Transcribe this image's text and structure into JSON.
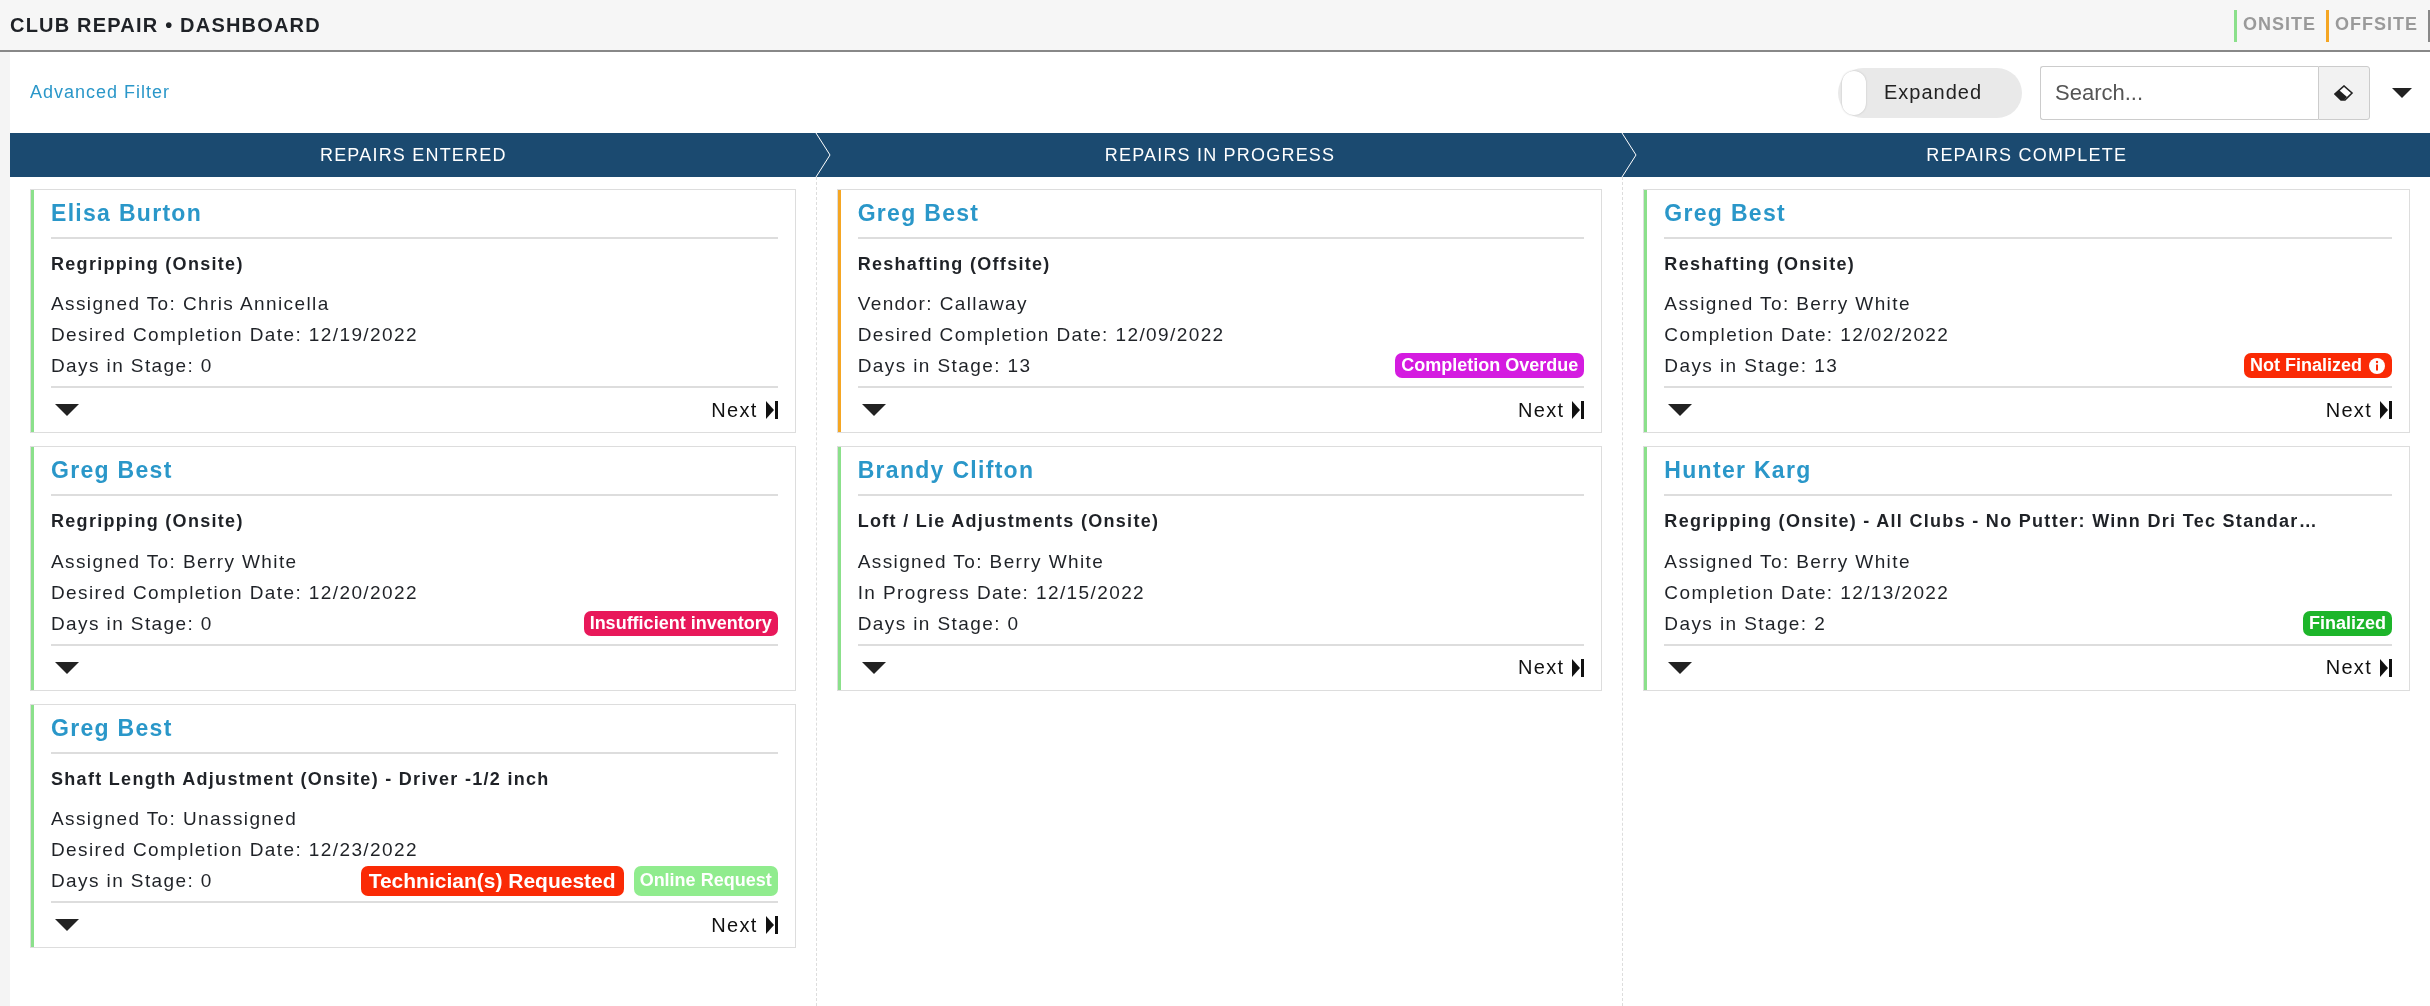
{
  "header": {
    "title": "CLUB REPAIR • DASHBOARD",
    "legend": [
      {
        "label": "ONSITE",
        "color": "#8be08b"
      },
      {
        "label": "OFFSITE",
        "color": "#f5a623"
      }
    ]
  },
  "toolbar": {
    "filter_link": "Advanced Filter",
    "expanded_toggle": {
      "label": "Expanded",
      "on": false
    },
    "search": {
      "placeholder": "Search..."
    }
  },
  "stages": [
    {
      "title": "REPAIRS ENTERED",
      "cards": [
        {
          "name": "Elisa Burton",
          "color": "#8be08b",
          "service": "Regripping (Onsite)",
          "lines": [
            "Assigned To: Chris Annicella",
            "Desired Completion Date: 12/19/2022",
            "Days in Stage: 0"
          ],
          "next": "Next"
        },
        {
          "name": "Greg Best",
          "color": "#8be08b",
          "service": "Regripping (Onsite)",
          "lines": [
            "Assigned To: Berry White",
            "Desired Completion Date: 12/20/2022",
            "Days in Stage: 0"
          ],
          "badges": [
            {
              "label": "Insufficient inventory",
              "color": "#e8185a",
              "kind": "plain"
            }
          ]
        },
        {
          "name": "Greg Best",
          "color": "#8be08b",
          "service": "Shaft Length Adjustment (Onsite) - Driver -1/2 inch",
          "lines": [
            "Assigned To: Unassigned",
            "Desired Completion Date: 12/23/2022",
            "Days in Stage: 0"
          ],
          "badges": [
            {
              "label": "Technician(s) Requested",
              "color": "#fa2a05",
              "kind": "large"
            },
            {
              "label": "Online Request",
              "color": "#90ec8e",
              "kind": "plain"
            }
          ],
          "next": "Next"
        }
      ]
    },
    {
      "title": "REPAIRS IN PROGRESS",
      "cards": [
        {
          "name": "Greg Best",
          "color": "#f5a623",
          "service": "Reshafting (Offsite)",
          "lines": [
            "Vendor: Callaway",
            "Desired Completion Date: 12/09/2022",
            "Days in Stage: 13"
          ],
          "badges": [
            {
              "label": "Completion Overdue",
              "color": "#d41ce0",
              "kind": "plain"
            }
          ],
          "next": "Next"
        },
        {
          "name": "Brandy Clifton",
          "color": "#8be08b",
          "service": "Loft / Lie Adjustments (Onsite)",
          "lines": [
            "Assigned To: Berry White",
            "In Progress Date: 12/15/2022",
            "Days in Stage: 0"
          ],
          "next": "Next"
        }
      ]
    },
    {
      "title": "REPAIRS COMPLETE",
      "cards": [
        {
          "name": "Greg Best",
          "color": "#8be08b",
          "service": "Reshafting (Onsite)",
          "lines": [
            "Assigned To: Berry White",
            "Completion Date: 12/02/2022",
            "Days in Stage: 13"
          ],
          "badges": [
            {
              "label": "Not Finalized",
              "color": "#fa2a05",
              "kind": "info"
            }
          ],
          "next": "Next"
        },
        {
          "name": "Hunter Karg",
          "color": "#8be08b",
          "service": "Regripping (Onsite) - All Clubs - No Putter: Winn Dri Tec Standar…",
          "lines": [
            "Assigned To: Berry White",
            "Completion Date: 12/13/2022",
            "Days in Stage: 2"
          ],
          "badges": [
            {
              "label": "Finalized",
              "color": "#1db52a",
              "kind": "plain"
            }
          ],
          "next": "Next"
        }
      ]
    }
  ]
}
